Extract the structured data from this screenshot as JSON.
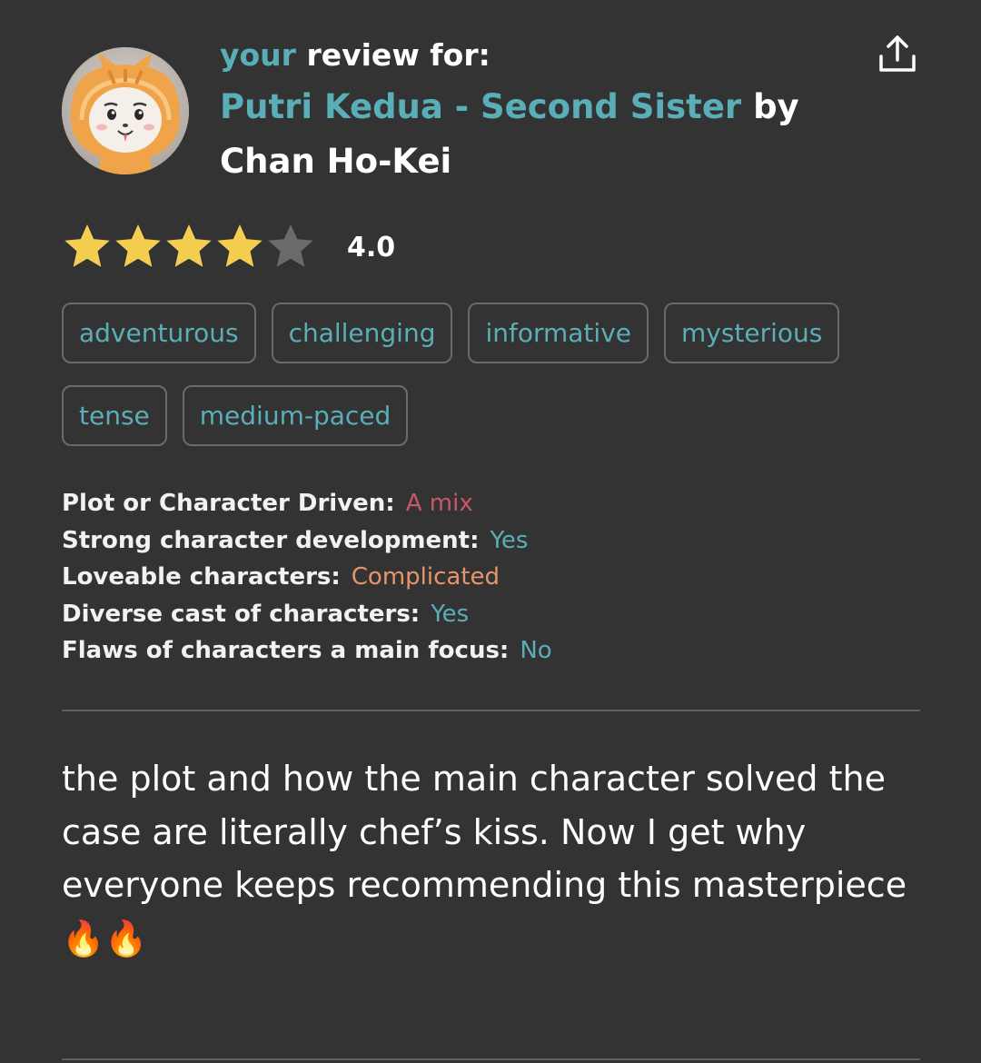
{
  "header": {
    "your": "your",
    "review_for": "review for:",
    "book_title": "Putri Kedua - Second Sister",
    "by": "by",
    "author": "Chan Ho-Kei"
  },
  "rating": {
    "value": 4.0,
    "display": "4.0",
    "max": 5,
    "star_color": "#f5cd51",
    "empty_star_color": "#6a6a6a"
  },
  "tags": [
    "adventurous",
    "challenging",
    "informative",
    "mysterious",
    "tense",
    "medium-paced"
  ],
  "details": [
    {
      "label": "Plot or Character Driven:",
      "value": "A mix",
      "color": "#c9566a"
    },
    {
      "label": "Strong character development:",
      "value": "Yes",
      "color": "#5aaeb8"
    },
    {
      "label": "Loveable characters:",
      "value": "Complicated",
      "color": "#e8946a"
    },
    {
      "label": "Diverse cast of characters:",
      "value": "Yes",
      "color": "#5aaeb8"
    },
    {
      "label": "Flaws of characters a main focus:",
      "value": "No",
      "color": "#5aaeb8"
    }
  ],
  "review": {
    "text": "the plot and how the main character solved the case are literally chef’s kiss. Now I get why everyone keeps recommending this masterpiece 🔥🔥"
  },
  "colors": {
    "background": "#333333",
    "accent": "#5aaeb8",
    "text": "#ffffff"
  },
  "icons": {
    "share": "share-icon",
    "avatar": "avatar-icon"
  }
}
